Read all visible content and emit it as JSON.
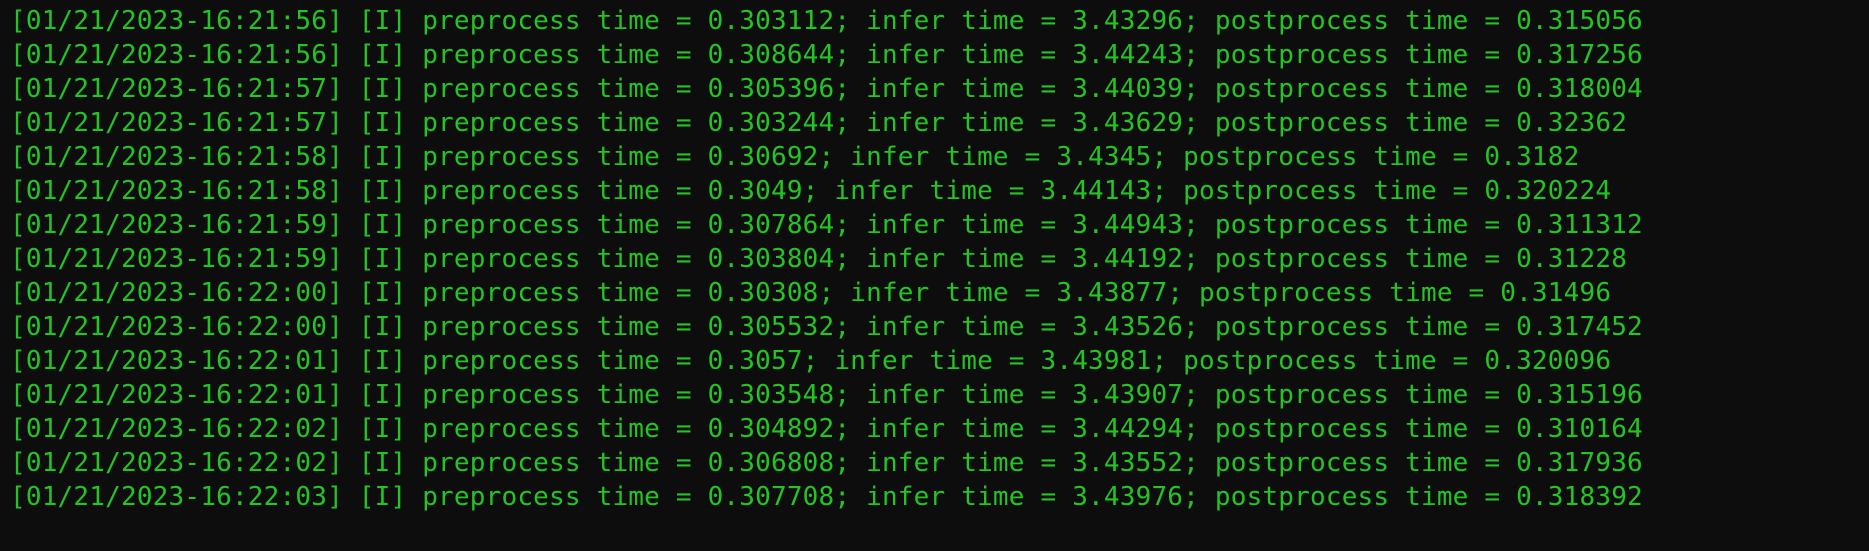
{
  "terminal": {
    "level_tag": "[I]",
    "entries": [
      {
        "timestamp": "01/21/2023-16:21:56",
        "preprocess": "0.303112",
        "infer": "3.43296",
        "postprocess": "0.315056"
      },
      {
        "timestamp": "01/21/2023-16:21:56",
        "preprocess": "0.308644",
        "infer": "3.44243",
        "postprocess": "0.317256"
      },
      {
        "timestamp": "01/21/2023-16:21:57",
        "preprocess": "0.305396",
        "infer": "3.44039",
        "postprocess": "0.318004"
      },
      {
        "timestamp": "01/21/2023-16:21:57",
        "preprocess": "0.303244",
        "infer": "3.43629",
        "postprocess": "0.32362"
      },
      {
        "timestamp": "01/21/2023-16:21:58",
        "preprocess": "0.30692",
        "infer": "3.4345",
        "postprocess": "0.3182"
      },
      {
        "timestamp": "01/21/2023-16:21:58",
        "preprocess": "0.3049",
        "infer": "3.44143",
        "postprocess": "0.320224"
      },
      {
        "timestamp": "01/21/2023-16:21:59",
        "preprocess": "0.307864",
        "infer": "3.44943",
        "postprocess": "0.311312"
      },
      {
        "timestamp": "01/21/2023-16:21:59",
        "preprocess": "0.303804",
        "infer": "3.44192",
        "postprocess": "0.31228"
      },
      {
        "timestamp": "01/21/2023-16:22:00",
        "preprocess": "0.30308",
        "infer": "3.43877",
        "postprocess": "0.31496"
      },
      {
        "timestamp": "01/21/2023-16:22:00",
        "preprocess": "0.305532",
        "infer": "3.43526",
        "postprocess": "0.317452"
      },
      {
        "timestamp": "01/21/2023-16:22:01",
        "preprocess": "0.3057",
        "infer": "3.43981",
        "postprocess": "0.320096"
      },
      {
        "timestamp": "01/21/2023-16:22:01",
        "preprocess": "0.303548",
        "infer": "3.43907",
        "postprocess": "0.315196"
      },
      {
        "timestamp": "01/21/2023-16:22:02",
        "preprocess": "0.304892",
        "infer": "3.44294",
        "postprocess": "0.310164"
      },
      {
        "timestamp": "01/21/2023-16:22:02",
        "preprocess": "0.306808",
        "infer": "3.43552",
        "postprocess": "0.317936"
      },
      {
        "timestamp": "01/21/2023-16:22:03",
        "preprocess": "0.307708",
        "infer": "3.43976",
        "postprocess": "0.318392"
      }
    ],
    "labels": {
      "preprocess": "preprocess time",
      "infer": "infer time",
      "postprocess": "postprocess time"
    }
  }
}
